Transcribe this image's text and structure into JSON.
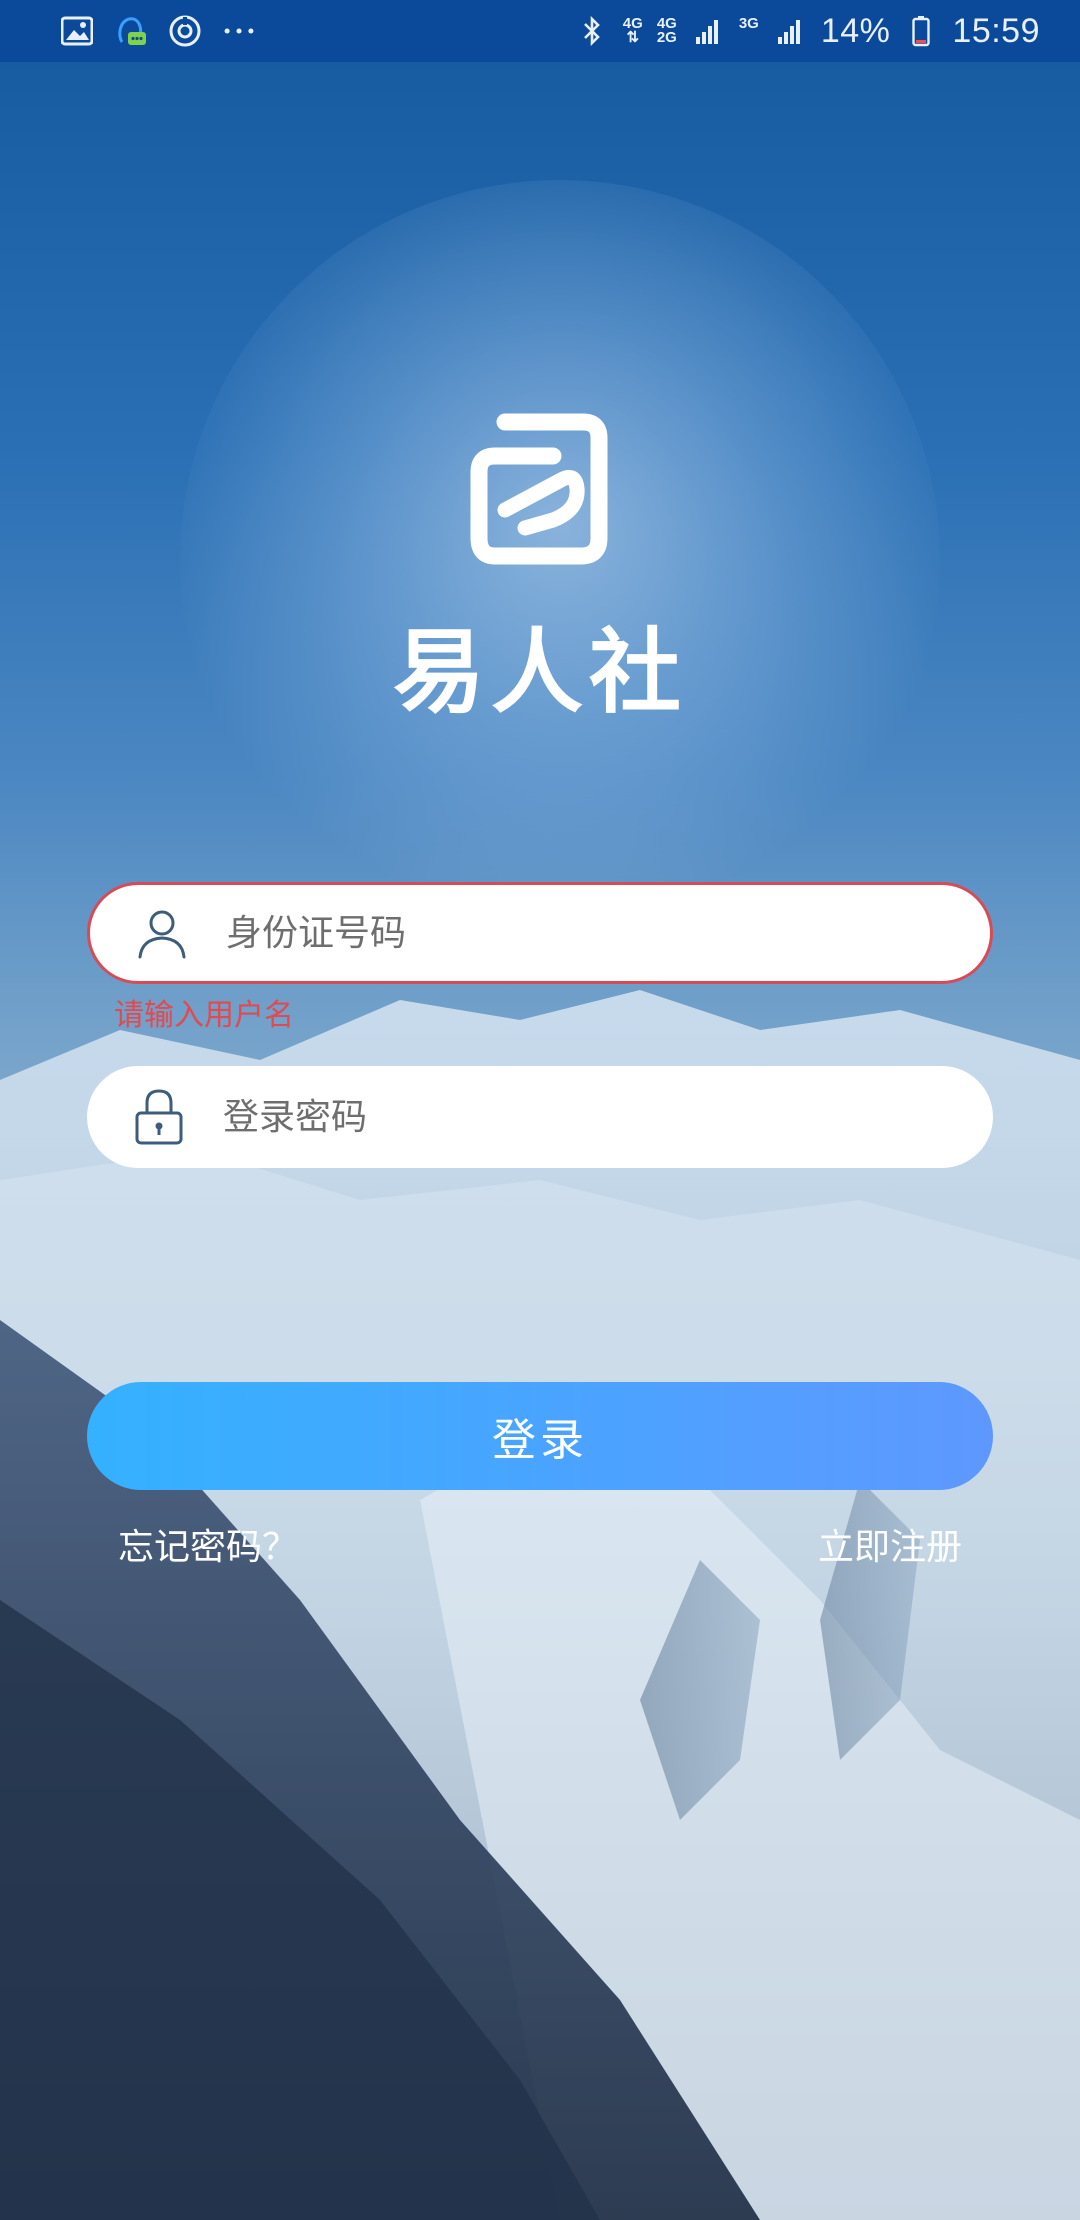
{
  "status_bar": {
    "left_icons": [
      "image-icon",
      "qq-message-icon",
      "refresh-circle-icon",
      "more-dots-icon"
    ],
    "network_1": "4G",
    "network_2_top": "4G",
    "network_2_bottom": "2G",
    "network_3": "3G",
    "battery": "14%",
    "time": "15:59"
  },
  "app": {
    "name": "易人社"
  },
  "form": {
    "id_placeholder": "身份证号码",
    "id_error": "请输入用户名",
    "password_placeholder": "登录密码",
    "login_label": "登录",
    "forgot_label": "忘记密码？",
    "register_label": "立即注册"
  },
  "colors": {
    "status_bar": "#0b4a9a",
    "error": "#e24a4f",
    "button_start": "#34b1ff",
    "button_end": "#5e98ff"
  }
}
